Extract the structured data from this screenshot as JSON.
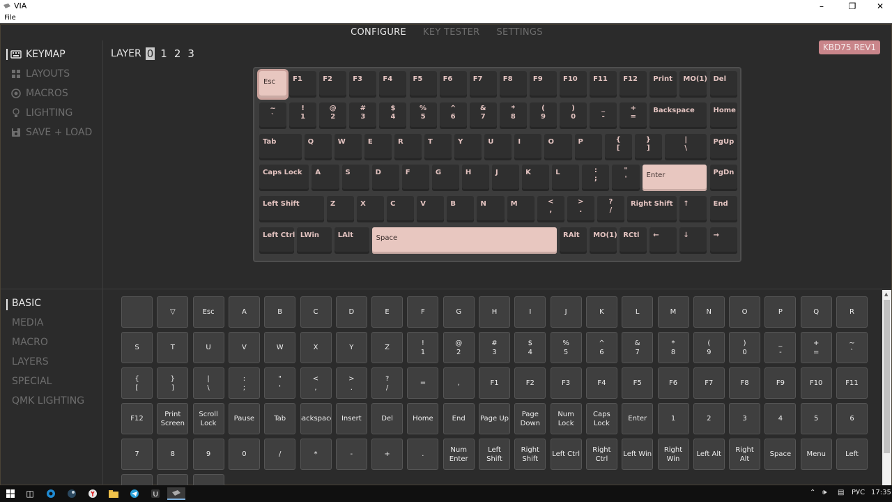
{
  "window": {
    "title": "VIA",
    "menu_file": "File"
  },
  "topnav": {
    "configure": "CONFIGURE",
    "key_tester": "KEY TESTER",
    "settings": "SETTINGS"
  },
  "sidebar": {
    "items": [
      "KEYMAP",
      "LAYOUTS",
      "MACROS",
      "LIGHTING",
      "SAVE + LOAD"
    ]
  },
  "layer": {
    "label": "LAYER",
    "numbers": [
      "0",
      "1",
      "2",
      "3"
    ]
  },
  "keyboard_name": "KBD75 REV1",
  "keyboard_keys": [
    "Esc",
    "F1",
    "F2",
    "F3",
    "F4",
    "F5",
    "F6",
    "F7",
    "F8",
    "F9",
    "F10",
    "F11",
    "F12",
    "Print",
    "MO(1)",
    "Del",
    "~\n`",
    "!\n1",
    "@\n2",
    "#\n3",
    "$\n4",
    "%\n5",
    "^\n6",
    "&\n7",
    "*\n8",
    "(\n9",
    ")\n0",
    "_\n-",
    "+\n=",
    "Backspace",
    "Home",
    "Tab",
    "Q",
    "W",
    "E",
    "R",
    "T",
    "Y",
    "U",
    "I",
    "O",
    "P",
    "{\n[",
    "}\n]",
    "|\n\\",
    "PgUp",
    "Caps Lock",
    "A",
    "S",
    "D",
    "F",
    "G",
    "H",
    "J",
    "K",
    "L",
    ":\n;",
    "\"\n'",
    "Enter",
    "PgDn",
    "Left Shift",
    "Z",
    "X",
    "C",
    "V",
    "B",
    "N",
    "M",
    "<\n,",
    ">\n.",
    "?\n/",
    "Right Shift",
    "↑",
    "End",
    "Left Ctrl",
    "LWin",
    "LAlt",
    "Space",
    "RAlt",
    "MO(1)",
    "RCtl",
    "←",
    "↓",
    "→"
  ],
  "categories": {
    "items": [
      "BASIC",
      "MEDIA",
      "MACRO",
      "LAYERS",
      "SPECIAL",
      "QMK LIGHTING"
    ]
  },
  "basic_keys": [
    "",
    "▽",
    "Esc",
    "A",
    "B",
    "C",
    "D",
    "E",
    "F",
    "G",
    "H",
    "I",
    "J",
    "K",
    "L",
    "M",
    "N",
    "O",
    "P",
    "Q",
    "R",
    "S",
    "T",
    "U",
    "V",
    "W",
    "X",
    "Y",
    "Z",
    "!\n1",
    "@\n2",
    "#\n3",
    "$\n4",
    "%\n5",
    "^\n6",
    "&\n7",
    "*\n8",
    "(\n9",
    ")\n0",
    "_\n-",
    "+\n=",
    "~\n`",
    "{\n[",
    "}\n]",
    "|\n\\",
    ":\n;",
    "\"\n'",
    "<\n,",
    ">\n.",
    "?\n/",
    "=",
    ",",
    "F1",
    "F2",
    "F3",
    "F4",
    "F5",
    "F6",
    "F7",
    "F8",
    "F9",
    "F10",
    "F11",
    "F12",
    "Print\nScreen",
    "Scroll\nLock",
    "Pause",
    "Tab",
    "Backspace",
    "Insert",
    "Del",
    "Home",
    "End",
    "Page Up",
    "Page\nDown",
    "Num\nLock",
    "Caps\nLock",
    "Enter",
    "1",
    "2",
    "3",
    "4",
    "5",
    "6",
    "7",
    "8",
    "9",
    "0",
    "/",
    "*",
    "-",
    "+",
    ".",
    "Num\nEnter",
    "Left\nShift",
    "Right\nShift",
    "Left Ctrl",
    "Right\nCtrl",
    "Left Win",
    "Right\nWin",
    "Left Alt",
    "Right Alt",
    "Space",
    "Menu",
    "Left",
    "",
    "",
    ""
  ],
  "taskbar": {
    "lang": "РУС",
    "time": "17:35"
  },
  "colors": {
    "accent_pink": "#e8c7c0",
    "legend_pink": "#e3c3c0",
    "badge": "#c9858a",
    "background": "#2b2b2b"
  }
}
